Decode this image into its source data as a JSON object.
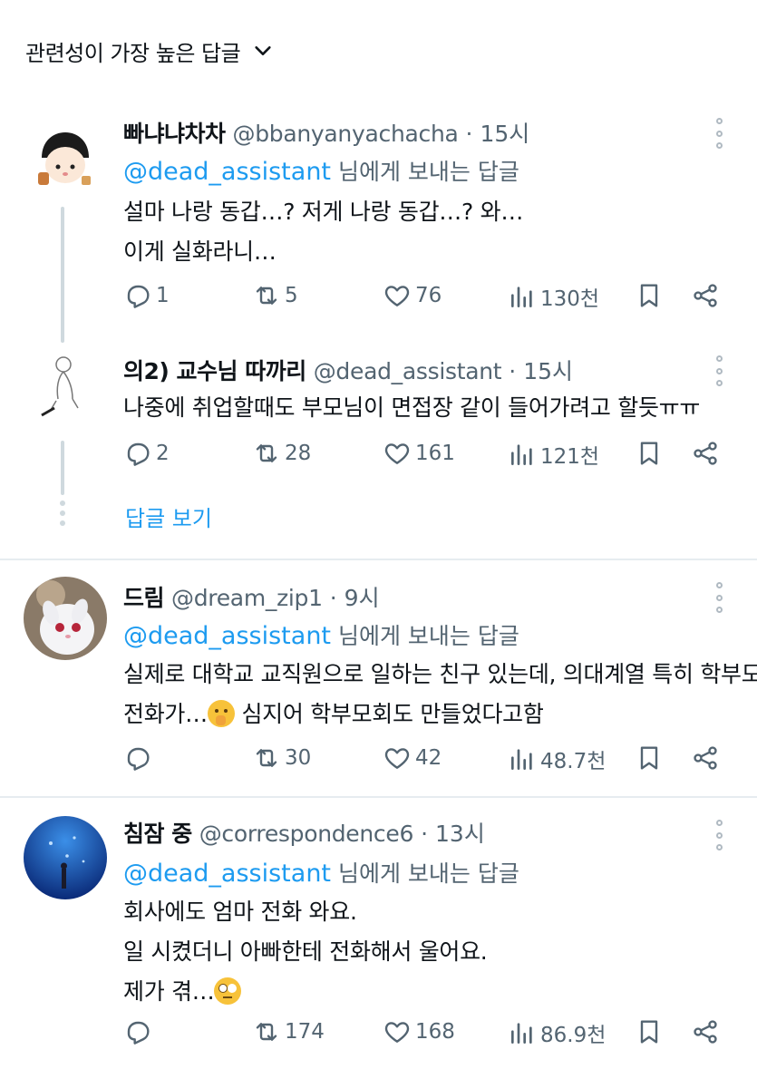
{
  "sort": {
    "label": "관련성이 가장 높은 답글"
  },
  "tweets": [
    {
      "display_name": "빠냐냐차차",
      "handle": "@bbanyanyachacha",
      "separator": "·",
      "time": "15시",
      "replying_mention": "@dead_assistant",
      "replying_suffix": " 님에게 보내는 답글",
      "lines": [
        "설마 나랑 동갑…? 저게 나랑 동갑…? 와…",
        "이게 실화라니…"
      ],
      "replies": "1",
      "retweets": "5",
      "likes": "76",
      "views": "130천"
    },
    {
      "display_name": "의2) 교수님 따까리",
      "handle": "@dead_assistant",
      "separator": "·",
      "time": "15시",
      "lines": [
        "나중에 취업할때도 부모님이 면접장 같이 들어가려고 할듯ㅠㅠ"
      ],
      "replies": "2",
      "retweets": "28",
      "likes": "161",
      "views": "121천"
    },
    {
      "display_name": "드림",
      "handle": "@dream_zip1",
      "separator": "·",
      "time": "9시",
      "replying_mention": "@dead_assistant",
      "replying_suffix": " 님에게 보내는 답글",
      "lines": [
        "실제로 대학교 교직원으로 일하는 친구 있는데, 의대계열 특히 학부모",
        "전화가…",
        " 심지어 학부모회도 만들었다고함"
      ],
      "replies": "",
      "retweets": "30",
      "likes": "42",
      "views": "48.7천"
    },
    {
      "display_name": "침잠 중",
      "handle": "@correspondence6",
      "separator": "·",
      "time": "13시",
      "replying_mention": "@dead_assistant",
      "replying_suffix": " 님에게 보내는 답글",
      "lines": [
        "회사에도 엄마 전화 와요.",
        "일 시켰더니 아빠한테 전화해서 울어요.",
        "제가 겪…"
      ],
      "replies": "",
      "retweets": "174",
      "likes": "168",
      "views": "86.9천"
    }
  ],
  "show_replies": "답글 보기",
  "colors": {
    "accent": "#1d9bf0",
    "muted": "#536471",
    "text": "#0f1419",
    "divider": "#e6ecf0"
  },
  "icons": [
    "chevron-down-icon",
    "more-icon",
    "reply-icon",
    "retweet-icon",
    "like-icon",
    "views-icon",
    "bookmark-icon",
    "share-icon",
    "shushing-face-emoji",
    "eye-roll-emoji"
  ]
}
